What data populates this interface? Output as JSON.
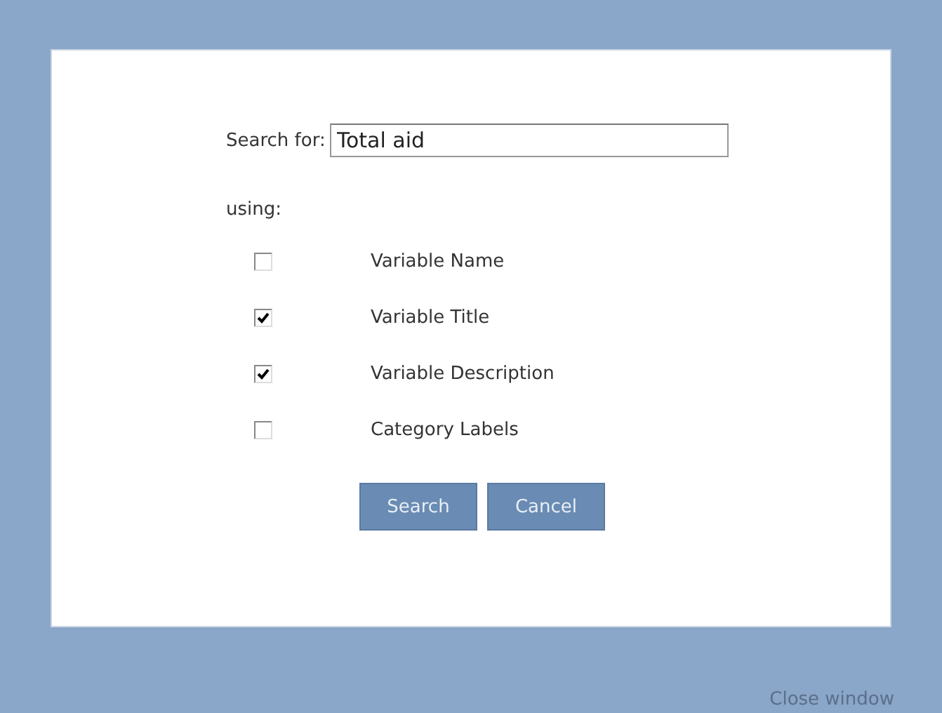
{
  "search": {
    "label": "Search for:",
    "value": "Total aid"
  },
  "using_label": "using:",
  "options": [
    {
      "label": "Variable Name",
      "checked": false
    },
    {
      "label": "Variable Title",
      "checked": true
    },
    {
      "label": "Variable Description",
      "checked": true
    },
    {
      "label": "Category Labels",
      "checked": false
    }
  ],
  "buttons": [
    "Search",
    "Cancel"
  ],
  "close_link": "Close window"
}
